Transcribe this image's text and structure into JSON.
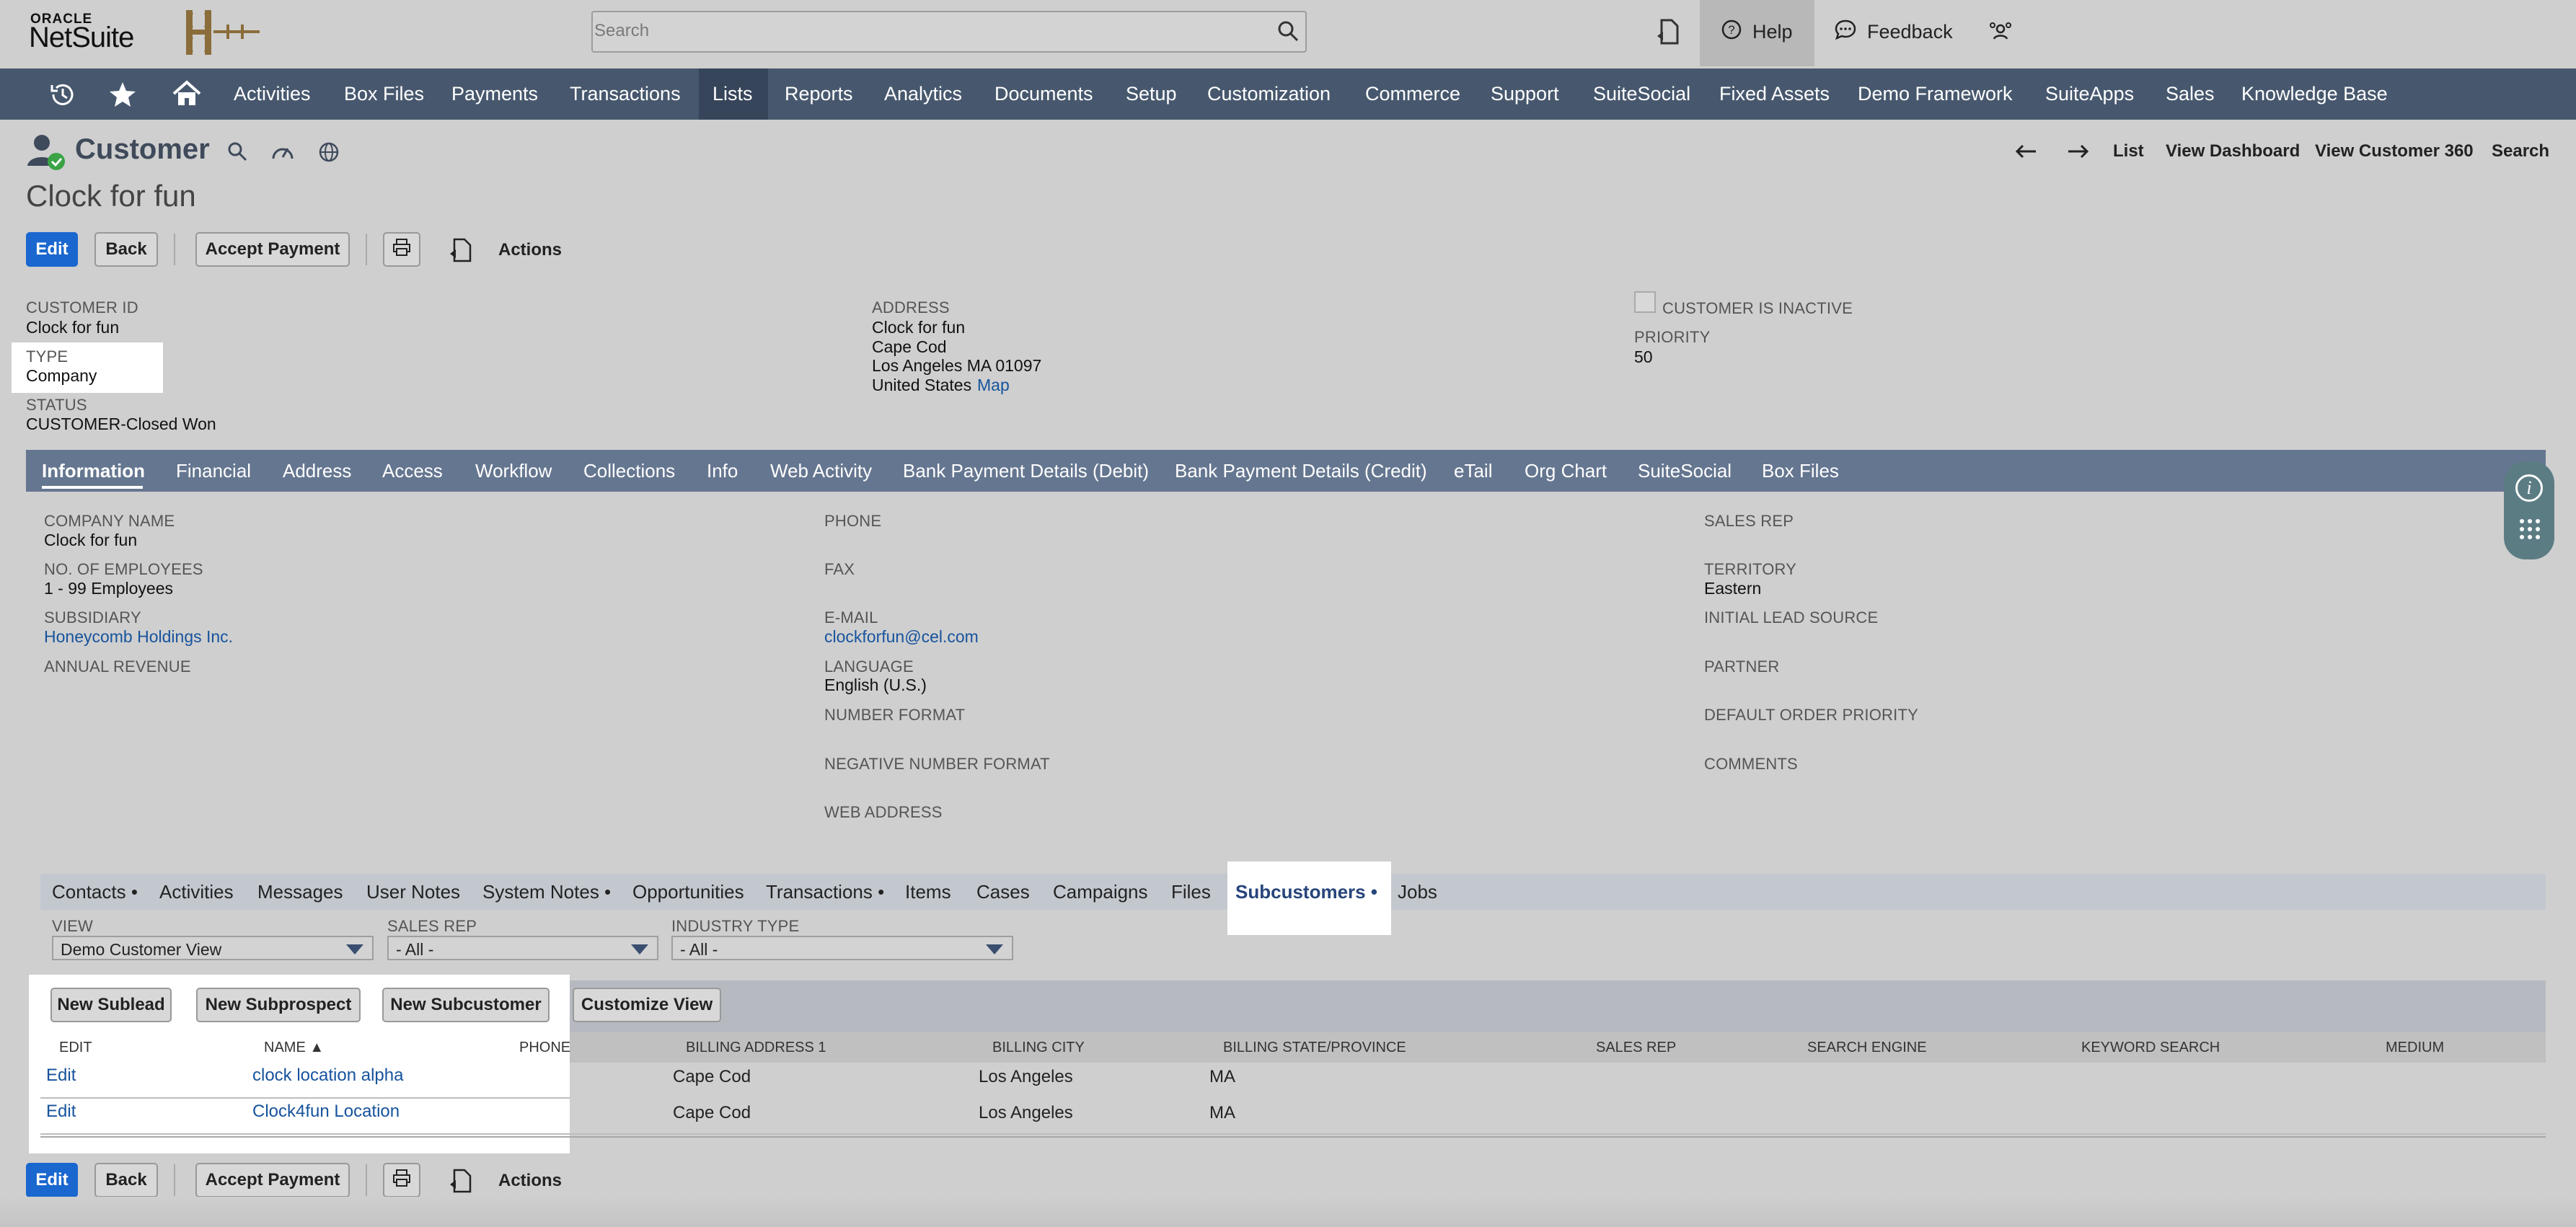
{
  "header": {
    "logo_top": "ORACLE",
    "logo_main": "NetSuite",
    "search_placeholder": "Search",
    "help": "Help",
    "feedback": "Feedback"
  },
  "nav": {
    "items": [
      "Activities",
      "Box Files",
      "Payments",
      "Transactions",
      "Lists",
      "Reports",
      "Analytics",
      "Documents",
      "Setup",
      "Customization",
      "Commerce",
      "Support",
      "SuiteSocial",
      "Fixed Assets",
      "Demo Framework",
      "SuiteApps",
      "Sales",
      "Knowledge Base"
    ],
    "active": "Lists"
  },
  "page": {
    "record_type": "Customer",
    "title": "Clock for fun",
    "links": [
      "List",
      "View Dashboard",
      "View Customer 360",
      "Search"
    ]
  },
  "buttons": {
    "edit": "Edit",
    "back": "Back",
    "accept_payment": "Accept Payment",
    "actions": "Actions"
  },
  "primary": {
    "customer_id_label": "CUSTOMER ID",
    "customer_id": "Clock for fun",
    "type_label": "TYPE",
    "type": "Company",
    "status_label": "STATUS",
    "status": "CUSTOMER-Closed Won",
    "address_label": "ADDRESS",
    "address_line1": "Clock for fun",
    "address_line2": "Cape Cod",
    "address_line3": "Los Angeles MA 01097",
    "address_line4": "United States",
    "map_link": "Map",
    "inactive_label": "CUSTOMER IS INACTIVE",
    "priority_label": "PRIORITY",
    "priority": "50"
  },
  "subtabs": [
    "Information",
    "Financial",
    "Address",
    "Access",
    "Workflow",
    "Collections",
    "Info",
    "Web Activity",
    "Bank Payment Details (Debit)",
    "Bank Payment Details (Credit)",
    "eTail",
    "Org Chart",
    "SuiteSocial",
    "Box Files"
  ],
  "info": {
    "company_name_label": "COMPANY NAME",
    "company_name": "Clock for fun",
    "employees_label": "NO. OF EMPLOYEES",
    "employees": "1 - 99 Employees",
    "subsidiary_label": "SUBSIDIARY",
    "subsidiary": "Honeycomb Holdings Inc.",
    "annual_revenue_label": "ANNUAL REVENUE",
    "phone_label": "PHONE",
    "fax_label": "FAX",
    "email_label": "E-MAIL",
    "email": "clockforfun@cel.com",
    "language_label": "LANGUAGE",
    "language": "English (U.S.)",
    "number_format_label": "NUMBER FORMAT",
    "negative_number_format_label": "NEGATIVE NUMBER FORMAT",
    "web_address_label": "WEB ADDRESS",
    "sales_rep_label": "SALES REP",
    "territory_label": "TERRITORY",
    "territory": "Eastern",
    "initial_lead_source_label": "INITIAL LEAD SOURCE",
    "partner_label": "PARTNER",
    "default_order_priority_label": "DEFAULT ORDER PRIORITY",
    "comments_label": "COMMENTS"
  },
  "sublists": {
    "tabs": [
      "Contacts •",
      "Activities",
      "Messages",
      "User Notes",
      "System Notes •",
      "Opportunities",
      "Transactions •",
      "Items",
      "Cases",
      "Campaigns",
      "Files",
      "Subcustomers •",
      "Jobs"
    ],
    "active": "Subcustomers •"
  },
  "filters": {
    "view_label": "VIEW",
    "view_value": "Demo Customer View",
    "sales_rep_label": "SALES REP",
    "sales_rep_value": "- All -",
    "industry_label": "INDUSTRY TYPE",
    "industry_value": "- All -"
  },
  "sublist_buttons": [
    "New Sublead",
    "New Subprospect",
    "New Subcustomer",
    "Customize View"
  ],
  "table": {
    "headers": [
      "EDIT",
      "NAME ▲",
      "PHONE",
      "BILLING ADDRESS 1",
      "BILLING CITY",
      "BILLING STATE/PROVINCE",
      "SALES REP",
      "SEARCH ENGINE",
      "KEYWORD SEARCH",
      "MEDIUM"
    ],
    "rows": [
      {
        "edit": "Edit",
        "name": "clock location alpha",
        "address": "Cape Cod",
        "city": "Los Angeles",
        "state": "MA"
      },
      {
        "edit": "Edit",
        "name": "Clock4fun Location",
        "address": "Cape Cod",
        "city": "Los Angeles",
        "state": "MA"
      }
    ]
  },
  "colors": {
    "nav_bg": "#47586e",
    "subtab_bg": "#657690",
    "primary_button": "#1a67cf",
    "link": "#16539d"
  }
}
